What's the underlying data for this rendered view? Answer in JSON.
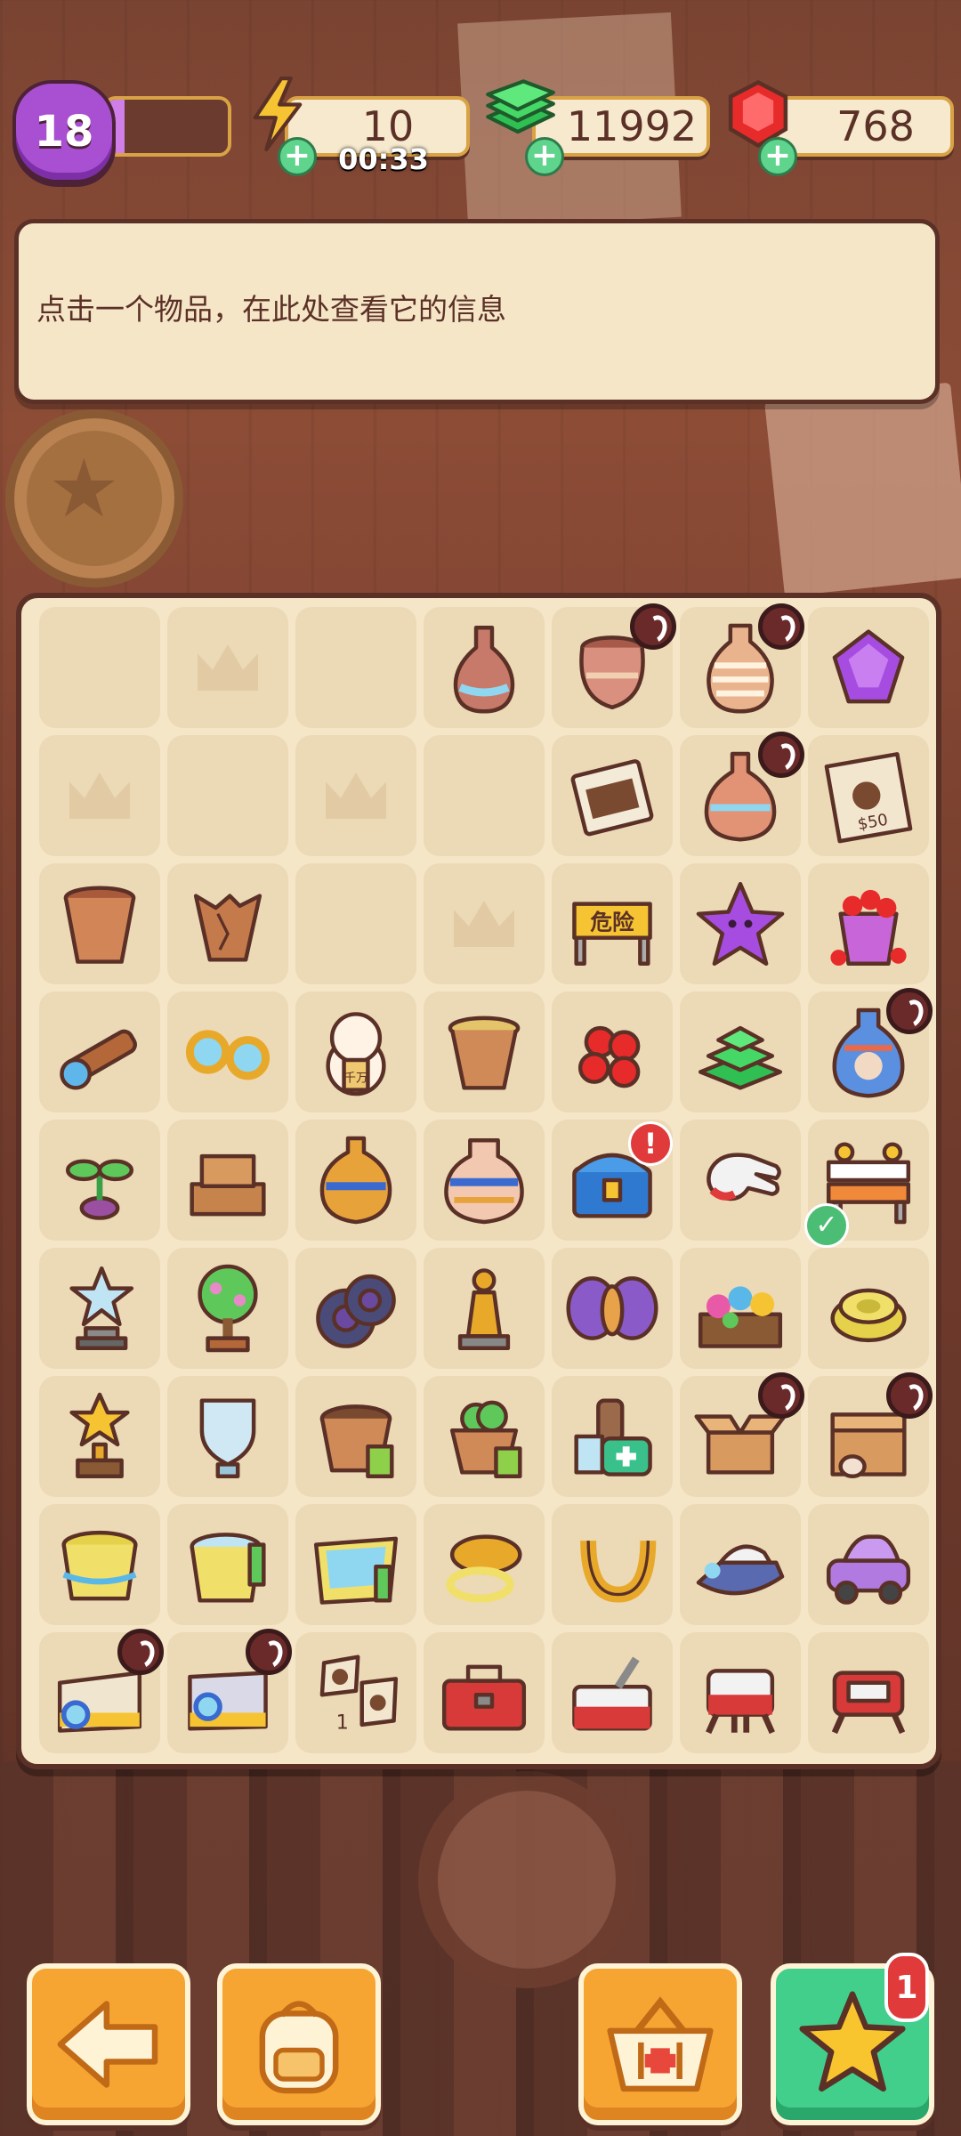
{
  "hud": {
    "level": "18",
    "xp_progress": 0.15,
    "energy": "10",
    "energy_timer": "00:33",
    "cash": "11992",
    "gems": "768"
  },
  "info": {
    "text": "点击一个物品，在此处查看它的信息"
  },
  "board": {
    "rows": [
      [
        {
          "t": "empty"
        },
        {
          "t": "locked-slot"
        },
        {
          "t": "empty"
        },
        {
          "t": "vase-tall"
        },
        {
          "t": "pot",
          "lock": true
        },
        {
          "t": "vase-striped",
          "lock": true
        },
        {
          "t": "purple-gem"
        }
      ],
      [
        {
          "t": "locked-slot"
        },
        {
          "t": "empty"
        },
        {
          "t": "locked-slot"
        },
        {
          "t": "empty"
        },
        {
          "t": "photo-bag"
        },
        {
          "t": "vase-round",
          "lock": true
        },
        {
          "t": "wanted-poster"
        }
      ],
      [
        {
          "t": "flower-pot"
        },
        {
          "t": "broken-pot"
        },
        {
          "t": "empty"
        },
        {
          "t": "locked-slot"
        },
        {
          "t": "danger-sign",
          "label": "危险"
        },
        {
          "t": "purple-star"
        },
        {
          "t": "ruby-bucket"
        }
      ],
      [
        {
          "t": "telescope"
        },
        {
          "t": "goggles"
        },
        {
          "t": "lucky-cat",
          "label": "千万"
        },
        {
          "t": "clay-pot"
        },
        {
          "t": "rubies"
        },
        {
          "t": "cash-pile"
        },
        {
          "t": "ornate-vase",
          "lock": true
        }
      ],
      [
        {
          "t": "sprout"
        },
        {
          "t": "crate-stack"
        },
        {
          "t": "amphora"
        },
        {
          "t": "ornate-urn"
        },
        {
          "t": "treasure-chest",
          "alert": "!"
        },
        {
          "t": "glove"
        },
        {
          "t": "barrier",
          "check": true
        }
      ],
      [
        {
          "t": "star-trophy"
        },
        {
          "t": "bonsai-tree"
        },
        {
          "t": "tires"
        },
        {
          "t": "pawn-trophy"
        },
        {
          "t": "moth"
        },
        {
          "t": "flower-crate"
        },
        {
          "t": "rope-coil"
        }
      ],
      [
        {
          "t": "gold-trophy"
        },
        {
          "t": "shield-trophy"
        },
        {
          "t": "soil-pot"
        },
        {
          "t": "plant-pot"
        },
        {
          "t": "first-aid"
        },
        {
          "t": "box-open",
          "lock": true
        },
        {
          "t": "box-wood",
          "lock": true
        }
      ],
      [
        {
          "t": "yellow-bucket"
        },
        {
          "t": "bucket-mop"
        },
        {
          "t": "water-tray"
        },
        {
          "t": "rope-bowl"
        },
        {
          "t": "horseshoe"
        },
        {
          "t": "jet-ski"
        },
        {
          "t": "purple-car"
        }
      ],
      [
        {
          "t": "map-magnifier",
          "lock": true
        },
        {
          "t": "map-magnifier2",
          "lock": true
        },
        {
          "t": "pawprint-pieces",
          "label": "1"
        },
        {
          "t": "toolbox-red"
        },
        {
          "t": "toolbox-open"
        },
        {
          "t": "toolbox-robot"
        },
        {
          "t": "toolbox-robot2"
        }
      ]
    ]
  },
  "buttons": {
    "shop_badge": "1"
  },
  "colors": {
    "panel": "#f6e6c8",
    "border": "#5b3127",
    "accent_orange": "#f6a533",
    "accent_green": "#42cf8c",
    "level_purple": "#a94fd1"
  }
}
